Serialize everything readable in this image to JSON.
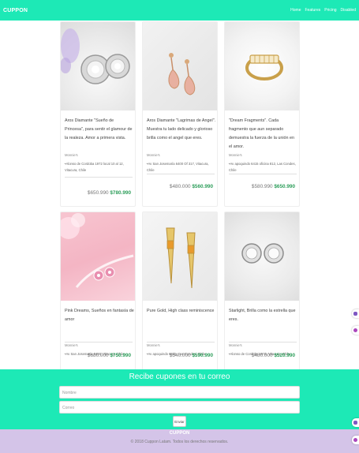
{
  "navbar": {
    "brand": "CUPPON",
    "links": [
      "Home",
      "Features",
      "Pricing",
      "Disabled"
    ]
  },
  "products": [
    {
      "title": "Aros Diamante \"Sueño de Princesa\", para sentir el glamour de la realeza. Amor a primera vista.",
      "store": "Monnie's",
      "address": "Alonso de Cordoba 1972 local 10 al 12, Vitacura, Chile",
      "old_price": "$650.990",
      "new_price": "$780.990",
      "image_icon": "diamond-stud-earrings"
    },
    {
      "title": "Aros Diamante \"Lagrimas de Angel\". Muestra tu lado delicado y glorioso brilla como el angel que eres.",
      "store": "Monnie's",
      "address": "Av San Josemaría 6400 Of 317, Vitacura, Chile",
      "old_price": "$480.000",
      "new_price": "$560.990",
      "image_icon": "teardrop-gold-earrings"
    },
    {
      "title": "\"Dream Fragments\". Cada fragmento que aun separado demuestra la fuerza de la unión en el amor.",
      "store": "Monnie's",
      "address": "Av apoquindo 6415 oficina 812, Las Condes, Chile",
      "old_price": "$580.990",
      "new_price": "$650.990",
      "image_icon": "gold-baguette-ring"
    },
    {
      "title": "Pink Dreams, Sueños en fantasía de amor",
      "store": "Monnie's",
      "address": "Av San Josemaría 6400, Vitacura, Chile.",
      "old_price": "$680.000",
      "new_price": "$750.990",
      "image_icon": "pink-flower-earrings"
    },
    {
      "title": "Pure Gold, High class reminiscence",
      "store": "Monnie's",
      "address": "Av apoquindo 6415, Las Condes, Chile.",
      "old_price": "$540.000",
      "new_price": "$590.990",
      "image_icon": "gold-topaz-earrings"
    },
    {
      "title": "Starlight, Brilla como la estrella que eres.",
      "store": "Monnie's",
      "address": "Alonso de Cordoba 1972, Vitacura, Chile",
      "old_price": "$480.000",
      "new_price": "$520.990",
      "image_icon": "silver-halo-earrings"
    }
  ],
  "subscribe": {
    "heading": "Recibe cupones en tu correo",
    "name_placeholder": "Nombre",
    "email_placeholder": "Correo",
    "submit_label": "Enviar"
  },
  "footer": {
    "brand": "CUPPON",
    "copyright": "© 2018 Cuppon Latam. Todos los derechos reservados."
  },
  "colors": {
    "accent": "#1de9b6",
    "footer": "#d4c4e8",
    "new_price": "#2e9e5b"
  }
}
